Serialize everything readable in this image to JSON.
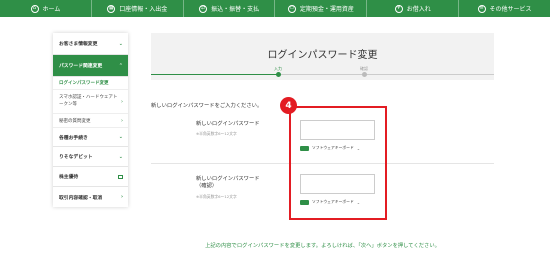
{
  "nav": {
    "items": [
      {
        "label": "ホーム",
        "icon": "home-icon"
      },
      {
        "label": "口座情報・入出金",
        "icon": "grid-icon"
      },
      {
        "label": "振込・振替・支払",
        "icon": "transfer-icon"
      },
      {
        "label": "定期預金・運用資産",
        "icon": "folder-icon"
      },
      {
        "label": "お借入れ",
        "icon": "bag-icon"
      },
      {
        "label": "その他サービス",
        "icon": "menu-icon"
      }
    ]
  },
  "sidebar": {
    "customer_info": "お客さま情報変更",
    "password_related": "パスワード関連変更",
    "login_pw_change": "ログインパスワード変更",
    "smartphone_auth": "スマホ認証・ハードウェアトークン等",
    "secret_question": "秘密の質問変更",
    "procedures": "各種お手続き",
    "debit": "りそなデビット",
    "shareholder": "株主優待",
    "transaction_history": "取引内容確認・取消"
  },
  "page": {
    "title": "ログインパスワード変更",
    "step1": "入力",
    "step2": "確認",
    "instruction": "新しいログインパスワードをご入力ください。",
    "field1_label": "新しいログインパスワード",
    "field1_hint": "※半角英数字6～12文字",
    "field2_label_line1": "新しいログインパスワード",
    "field2_label_line2": "（確認）",
    "field2_hint": "※半角英数字6～12文字",
    "keyboard_label": "ソフトウェアキーボード",
    "badge": "4",
    "footer_note": "上記の内容でログインパスワードを変更します。よろしければ、「次へ」ボタンを押してください。"
  },
  "colors": {
    "brand_green": "#2f8f47",
    "highlight_red": "#e31c23"
  }
}
